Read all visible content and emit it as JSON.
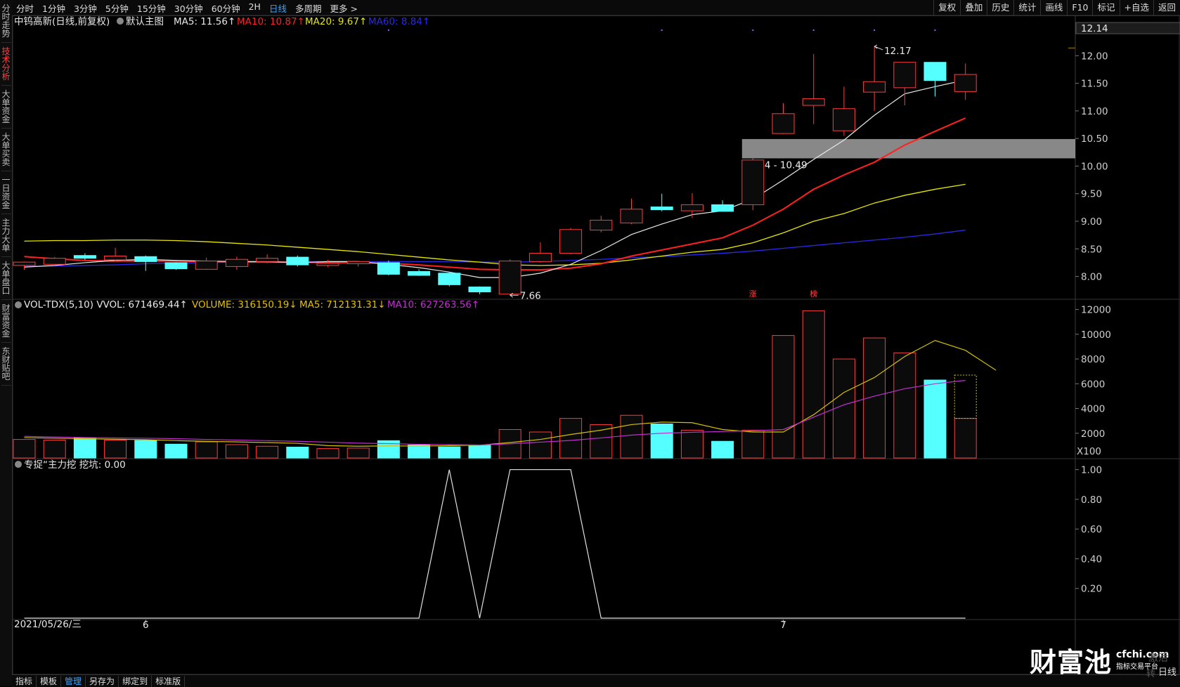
{
  "sidebar": {
    "tabs": [
      "分时走势",
      "技术分析",
      "大单资金",
      "大单买卖",
      "一日资金",
      "主力大单",
      "大单盘口",
      "财富资金",
      "东财贴吧"
    ],
    "active_index": 1
  },
  "toolbar": {
    "periods": [
      "分时",
      "1分钟",
      "3分钟",
      "5分钟",
      "15分钟",
      "30分钟",
      "60分钟",
      "2H",
      "日线",
      "多周期",
      "更多 >"
    ],
    "active_period_index": 8,
    "right_items": [
      "复权",
      "叠加",
      "历史",
      "统计",
      "画线",
      "F10",
      "标记",
      "+自选",
      "返回"
    ]
  },
  "bottom_bar": {
    "items": [
      "指标",
      "模板",
      "管理",
      "另存为",
      "绑定到",
      "标准版"
    ],
    "active_index": 2
  },
  "watermark": {
    "main": "财富池",
    "domain": "cfchi.com",
    "slogan": "指标交易平台",
    "overlay_1": "激活",
    "overlay_2": "转",
    "overlay_3": "日线"
  },
  "colors": {
    "up": "#ff3b3b",
    "down": "#55ffff",
    "ma5": "#e8e8e8",
    "ma10": "#ff2020",
    "ma20": "#e6e600",
    "ma60": "#2a2ae6",
    "vol_ma5": "#d4c000",
    "vol_ma10": "#c030d0",
    "zone": "#a0a0a0"
  },
  "chart_data": [
    {
      "type": "candlestick",
      "header": {
        "stock": "中钨高新(日线,前复权)",
        "template": "默认主图",
        "ma5": "MA5: 11.56↑",
        "ma10": "MA10: 10.87↑",
        "ma20": "MA20: 9.67↑",
        "ma60": "MA60: 8.84↑"
      },
      "ylim": [
        7.6,
        12.5
      ],
      "y_ticks": [
        8.0,
        8.5,
        9.0,
        9.5,
        10.0,
        10.5,
        11.0,
        11.5,
        12.0
      ],
      "y_tick_labels": [
        "8.00",
        "8.50",
        "9.00",
        "9.50",
        "10.00",
        "10.50",
        "11.00",
        "11.50",
        "12.00"
      ],
      "current_price_label": "12.14",
      "candles": [
        {
          "o": 8.2,
          "h": 8.27,
          "l": 8.12,
          "c": 8.26
        },
        {
          "o": 8.22,
          "h": 8.35,
          "l": 8.18,
          "c": 8.33
        },
        {
          "o": 8.38,
          "h": 8.42,
          "l": 8.3,
          "c": 8.33
        },
        {
          "o": 8.3,
          "h": 8.52,
          "l": 8.28,
          "c": 8.37
        },
        {
          "o": 8.36,
          "h": 8.38,
          "l": 8.1,
          "c": 8.27
        },
        {
          "o": 8.25,
          "h": 8.26,
          "l": 8.12,
          "c": 8.14
        },
        {
          "o": 8.13,
          "h": 8.34,
          "l": 8.12,
          "c": 8.28
        },
        {
          "o": 8.18,
          "h": 8.36,
          "l": 8.12,
          "c": 8.31
        },
        {
          "o": 8.27,
          "h": 8.4,
          "l": 8.24,
          "c": 8.33
        },
        {
          "o": 8.35,
          "h": 8.38,
          "l": 8.18,
          "c": 8.21
        },
        {
          "o": 8.2,
          "h": 8.3,
          "l": 8.17,
          "c": 8.24
        },
        {
          "o": 8.23,
          "h": 8.28,
          "l": 8.18,
          "c": 8.27
        },
        {
          "o": 8.25,
          "h": 8.29,
          "l": 8.02,
          "c": 8.04
        },
        {
          "o": 8.09,
          "h": 8.13,
          "l": 8.01,
          "c": 8.02
        },
        {
          "o": 8.06,
          "h": 8.07,
          "l": 7.82,
          "c": 7.85
        },
        {
          "o": 7.81,
          "h": 7.82,
          "l": 7.68,
          "c": 7.72
        },
        {
          "o": 7.68,
          "h": 8.31,
          "l": 7.66,
          "c": 8.28
        },
        {
          "o": 8.27,
          "h": 8.62,
          "l": 8.25,
          "c": 8.42
        },
        {
          "o": 8.42,
          "h": 8.88,
          "l": 8.4,
          "c": 8.85
        },
        {
          "o": 8.84,
          "h": 9.1,
          "l": 8.8,
          "c": 9.02
        },
        {
          "o": 8.97,
          "h": 9.41,
          "l": 8.95,
          "c": 9.22
        },
        {
          "o": 9.26,
          "h": 9.5,
          "l": 9.18,
          "c": 9.21
        },
        {
          "o": 9.19,
          "h": 9.51,
          "l": 9.06,
          "c": 9.3
        },
        {
          "o": 9.3,
          "h": 9.38,
          "l": 9.18,
          "c": 9.18
        },
        {
          "o": 9.3,
          "h": 10.14,
          "l": 9.2,
          "c": 10.11
        },
        {
          "o": 10.59,
          "h": 11.14,
          "l": 10.58,
          "c": 10.95
        },
        {
          "o": 11.1,
          "h": 12.03,
          "l": 10.76,
          "c": 11.22
        },
        {
          "o": 10.64,
          "h": 11.44,
          "l": 10.55,
          "c": 11.04
        },
        {
          "o": 11.34,
          "h": 12.17,
          "l": 11.0,
          "c": 11.53
        },
        {
          "o": 11.42,
          "h": 11.88,
          "l": 11.1,
          "c": 11.88
        },
        {
          "o": 11.88,
          "h": 11.88,
          "l": 11.26,
          "c": 11.55
        },
        {
          "o": 11.35,
          "h": 11.86,
          "l": 11.2,
          "c": 11.66
        }
      ],
      "ma5": [
        8.17,
        8.2,
        8.25,
        8.29,
        8.31,
        8.29,
        8.28,
        8.27,
        8.27,
        8.25,
        8.27,
        8.27,
        8.22,
        8.16,
        8.08,
        7.98,
        7.98,
        8.06,
        8.22,
        8.47,
        8.76,
        8.95,
        9.12,
        9.19,
        9.4,
        9.75,
        10.12,
        10.47,
        10.92,
        11.31,
        11.44,
        11.56
      ],
      "ma10": [
        8.36,
        8.32,
        8.29,
        8.28,
        8.28,
        8.28,
        8.27,
        8.26,
        8.26,
        8.26,
        8.25,
        8.25,
        8.24,
        8.21,
        8.17,
        8.13,
        8.12,
        8.12,
        8.15,
        8.23,
        8.37,
        8.48,
        8.59,
        8.7,
        8.93,
        9.22,
        9.58,
        9.84,
        10.07,
        10.38,
        10.63,
        10.87
      ],
      "ma20": [
        8.64,
        8.65,
        8.65,
        8.66,
        8.66,
        8.65,
        8.63,
        8.6,
        8.57,
        8.53,
        8.49,
        8.45,
        8.4,
        8.35,
        8.3,
        8.26,
        8.21,
        8.2,
        8.21,
        8.24,
        8.3,
        8.37,
        8.44,
        8.49,
        8.61,
        8.79,
        9.0,
        9.14,
        9.33,
        9.47,
        9.58,
        9.67
      ],
      "ma60": [
        8.18,
        8.19,
        8.2,
        8.21,
        8.23,
        8.24,
        8.25,
        8.26,
        8.26,
        8.27,
        8.27,
        8.27,
        8.27,
        8.27,
        8.27,
        8.26,
        8.26,
        8.27,
        8.29,
        8.31,
        8.34,
        8.36,
        8.39,
        8.42,
        8.46,
        8.51,
        8.56,
        8.61,
        8.66,
        8.71,
        8.77,
        8.84
      ],
      "zone": {
        "low": 10.14,
        "high": 10.49,
        "start_index": 24,
        "label": "10.14 - 10.49"
      },
      "annotations": [
        {
          "index": 28,
          "price": 12.17,
          "label": "12.17",
          "position": "high"
        },
        {
          "index": 16,
          "price": 7.66,
          "label": "7.66",
          "position": "low"
        }
      ],
      "events": [
        {
          "index": 24,
          "label": "涨"
        },
        {
          "index": 26,
          "label": "榜"
        }
      ],
      "marker_dot_indices": [
        12,
        21,
        24,
        26,
        28,
        30
      ]
    },
    {
      "type": "bar",
      "header": {
        "indicator": "VOL-TDX(5,10)",
        "vvol": "VVOL: 671469.44↑",
        "volume": "VOLUME: 316150.19↓",
        "ma5": "MA5: 712131.31↓",
        "ma10": "MA10: 627263.56↑"
      },
      "unit": "X100",
      "ylim": [
        0,
        12600
      ],
      "y_ticks": [
        2000,
        4000,
        6000,
        8000,
        10000,
        12000
      ],
      "y_tick_labels": [
        "2000",
        "4000",
        "6000",
        "8000",
        "10000",
        "12000"
      ],
      "values": [
        1500,
        1450,
        1620,
        1450,
        1420,
        1120,
        1300,
        1080,
        950,
        880,
        760,
        800,
        1400,
        1050,
        900,
        1050,
        2300,
        2100,
        3200,
        2700,
        3450,
        2750,
        2250,
        1350,
        2250,
        9900,
        11900,
        8000,
        9700,
        8500,
        6300,
        3200
      ],
      "up": [
        true,
        true,
        false,
        true,
        false,
        false,
        true,
        true,
        true,
        false,
        true,
        true,
        false,
        false,
        false,
        false,
        true,
        true,
        true,
        true,
        true,
        false,
        true,
        false,
        true,
        true,
        true,
        true,
        true,
        true,
        false,
        true
      ],
      "last_bar_total": 6700,
      "ma5": [
        1650,
        1600,
        1550,
        1520,
        1480,
        1400,
        1350,
        1300,
        1250,
        1180,
        1000,
        950,
        980,
        960,
        1000,
        1040,
        1250,
        1500,
        1900,
        2250,
        2700,
        2900,
        2850,
        2300,
        2100,
        2100,
        3500,
        5300,
        6500,
        8200,
        9500,
        8700,
        7100
      ],
      "ma10": [
        1750,
        1700,
        1650,
        1620,
        1600,
        1560,
        1500,
        1450,
        1400,
        1350,
        1280,
        1200,
        1160,
        1110,
        1080,
        1050,
        1150,
        1280,
        1420,
        1620,
        1850,
        2000,
        2080,
        2140,
        2200,
        2300,
        3300,
        4300,
        5000,
        5600,
        6000,
        6272
      ]
    },
    {
      "type": "line",
      "header": {
        "indicator": "专捉“主力挖 挖坑: 0.00"
      },
      "ylim": [
        0,
        1.05
      ],
      "y_ticks": [
        0.2,
        0.4,
        0.6,
        0.8,
        1.0
      ],
      "y_tick_labels": [
        "0.20",
        "0.40",
        "0.60",
        "0.80",
        "1.00"
      ],
      "values": [
        0,
        0,
        0,
        0,
        0,
        0,
        0,
        0,
        0,
        0,
        0,
        0,
        0,
        0,
        1,
        0,
        1,
        1,
        1,
        0,
        0,
        0,
        0,
        0,
        0,
        0,
        0,
        0,
        0,
        0,
        0,
        0
      ]
    }
  ],
  "x_axis": {
    "date_label": "2021/05/26/三",
    "month_labels": [
      {
        "index": 4,
        "label": "6"
      },
      {
        "index": 25,
        "label": "7"
      }
    ]
  }
}
